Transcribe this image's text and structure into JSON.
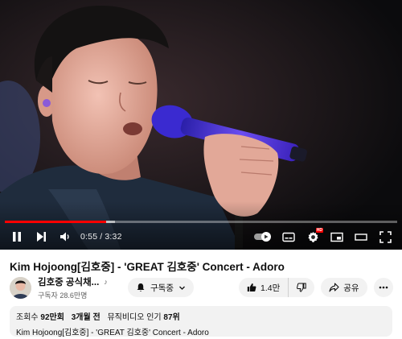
{
  "player": {
    "current_time": "0:55",
    "separator": "/",
    "duration": "3:32",
    "progress_fraction": 0.259,
    "buffered_fraction": 0.28,
    "progress_color": "#ff0000",
    "settings_badge": "HD",
    "controls": [
      "pause-icon",
      "next-icon",
      "volume-icon",
      "autoplay-toggle",
      "subtitles-icon",
      "settings-icon",
      "miniplayer-icon",
      "theater-icon",
      "fullscreen-icon"
    ]
  },
  "video": {
    "title": "Kim Hojoong[김호중] - 'GREAT 김호중' Concert - Adoro"
  },
  "channel": {
    "name": "김호중 공식채...",
    "music_note": "♪",
    "subscribers": "구독자 28.6만명",
    "subscribe_label": "구독중"
  },
  "actions": {
    "likes": "1.4만",
    "share_label": "공유"
  },
  "description": {
    "views_label": "조회수",
    "views": "92만회",
    "age": "3개월 전",
    "category": "뮤직비디오 인기",
    "rank": "87위",
    "text": "Kim Hojoong[김호중] - 'GREAT 김호중' Concert - Adoro"
  }
}
